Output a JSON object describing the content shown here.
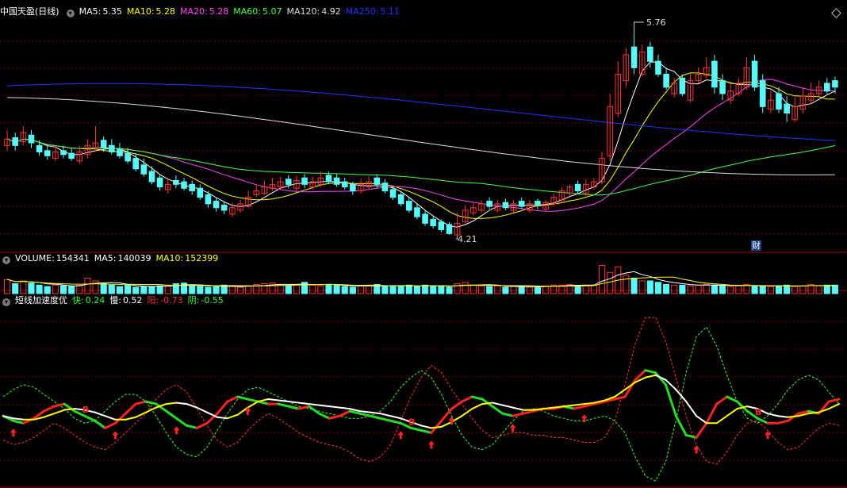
{
  "main_panel": {
    "stock_name": "中国天盈",
    "period": "(日线)",
    "indicators": [
      {
        "label": "MA5:",
        "value": "5.35",
        "color": "#ffffff"
      },
      {
        "label": "MA10:",
        "value": "5.28",
        "color": "#ffff00"
      },
      {
        "label": "MA20:",
        "value": "5.28",
        "color": "#ff44ff"
      },
      {
        "label": "MA60:",
        "value": "5.07",
        "color": "#44ff44"
      },
      {
        "label": "MA120:",
        "value": "4.92",
        "color": "#dddddd"
      },
      {
        "label": "MA250:",
        "value": "5.11",
        "color": "#2233ff"
      }
    ],
    "high_label": "5.76",
    "low_label": "4.21",
    "finance_marker": "财"
  },
  "volume_panel": {
    "indicators": [
      {
        "label": "VOLUME:",
        "value": "154341",
        "color": "#ffffff"
      },
      {
        "label": "MA5:",
        "value": "140039",
        "color": "#ffffff"
      },
      {
        "label": "MA10:",
        "value": "152399",
        "color": "#ffff00"
      }
    ]
  },
  "oscillator_panel": {
    "name": "短线加速度优",
    "indicators": [
      {
        "label": "快:",
        "value": "0.24",
        "color": "#33ff33"
      },
      {
        "label": "慢:",
        "value": "0.52",
        "color": "#ffffff"
      },
      {
        "label": "阳:",
        "value": "-0.73",
        "color": "#ff3333"
      },
      {
        "label": "阴:",
        "value": "-0.55",
        "color": "#33ff33"
      }
    ],
    "buy_markers": [
      "B",
      "B",
      "B"
    ]
  },
  "colors": {
    "up": "#ff3232",
    "down": "#54fcfc",
    "grid": "#7a0000",
    "border": "#aa0000"
  },
  "chart_data": [
    {
      "type": "candlestick",
      "ylim": [
        4.1,
        5.9
      ],
      "close": [
        4.95,
        4.9,
        5.0,
        4.92,
        4.85,
        4.82,
        4.85,
        4.83,
        4.8,
        4.85,
        4.9,
        4.92,
        4.88,
        4.85,
        4.82,
        4.78,
        4.72,
        4.68,
        4.62,
        4.58,
        4.6,
        4.6,
        4.57,
        4.55,
        4.5,
        4.45,
        4.42,
        4.4,
        4.42,
        4.45,
        4.5,
        4.55,
        4.58,
        4.6,
        4.62,
        4.6,
        4.63,
        4.6,
        4.62,
        4.65,
        4.62,
        4.6,
        4.58,
        4.55,
        4.6,
        4.62,
        4.6,
        4.55,
        4.5,
        4.45,
        4.4,
        4.35,
        4.3,
        4.28,
        4.25,
        4.22,
        4.3,
        4.4,
        4.42,
        4.45,
        4.43,
        4.45,
        4.42,
        4.45,
        4.43,
        4.45,
        4.44,
        4.46,
        4.5,
        4.55,
        4.58,
        4.55,
        4.6,
        4.62,
        4.8,
        5.2,
        5.45,
        5.6,
        5.5,
        5.62,
        5.55,
        5.45,
        5.35,
        5.38,
        5.3,
        5.4,
        5.45,
        5.5,
        5.35,
        5.3,
        5.32,
        5.38,
        5.5,
        5.35,
        5.2,
        5.25,
        5.18,
        5.15,
        5.2,
        5.28,
        5.3,
        5.35,
        5.32,
        5.35
      ],
      "open": [
        4.9,
        4.96,
        4.93,
        4.98,
        4.9,
        4.86,
        4.8,
        4.86,
        4.84,
        4.78,
        4.83,
        4.88,
        4.94,
        4.9,
        4.87,
        4.84,
        4.8,
        4.75,
        4.7,
        4.65,
        4.56,
        4.63,
        4.62,
        4.6,
        4.57,
        4.52,
        4.47,
        4.44,
        4.37,
        4.4,
        4.43,
        4.52,
        4.53,
        4.57,
        4.58,
        4.64,
        4.57,
        4.65,
        4.58,
        4.6,
        4.67,
        4.65,
        4.62,
        4.6,
        4.55,
        4.58,
        4.65,
        4.61,
        4.56,
        4.52,
        4.47,
        4.42,
        4.37,
        4.33,
        4.31,
        4.29,
        4.21,
        4.31,
        4.38,
        4.4,
        4.47,
        4.4,
        4.46,
        4.4,
        4.47,
        4.4,
        4.47,
        4.41,
        4.45,
        4.48,
        4.53,
        4.6,
        4.53,
        4.58,
        4.62,
        4.82,
        5.15,
        5.4,
        5.66,
        5.45,
        5.66,
        5.55,
        5.45,
        5.3,
        5.42,
        5.25,
        5.4,
        5.44,
        5.55,
        5.4,
        5.25,
        5.3,
        5.35,
        5.55,
        5.4,
        5.18,
        5.3,
        5.22,
        5.1,
        5.18,
        5.25,
        5.3,
        5.38,
        5.4
      ],
      "high": [
        5.02,
        5.0,
        5.05,
        5.02,
        4.94,
        4.9,
        4.9,
        4.9,
        4.88,
        4.9,
        4.95,
        5.05,
        4.97,
        4.95,
        4.92,
        4.88,
        4.84,
        4.8,
        4.74,
        4.68,
        4.64,
        4.67,
        4.65,
        4.63,
        4.6,
        4.55,
        4.5,
        4.47,
        4.46,
        4.48,
        4.55,
        4.6,
        4.63,
        4.65,
        4.66,
        4.67,
        4.67,
        4.68,
        4.66,
        4.7,
        4.7,
        4.68,
        4.65,
        4.62,
        4.64,
        4.66,
        4.68,
        4.64,
        4.58,
        4.54,
        4.5,
        4.45,
        4.4,
        4.36,
        4.33,
        4.31,
        4.38,
        4.44,
        4.46,
        4.48,
        4.5,
        4.48,
        4.49,
        4.48,
        4.5,
        4.48,
        4.49,
        4.48,
        4.53,
        4.58,
        4.6,
        4.63,
        4.64,
        4.65,
        4.85,
        5.3,
        5.55,
        5.65,
        5.76,
        5.68,
        5.7,
        5.6,
        5.5,
        5.42,
        5.45,
        5.45,
        5.5,
        5.58,
        5.6,
        5.45,
        5.38,
        5.42,
        5.58,
        5.6,
        5.45,
        5.32,
        5.35,
        5.28,
        5.28,
        5.35,
        5.38,
        5.4,
        5.42,
        5.43
      ],
      "low": [
        4.86,
        4.86,
        4.9,
        4.88,
        4.82,
        4.79,
        4.78,
        4.8,
        4.78,
        4.76,
        4.8,
        4.85,
        4.85,
        4.83,
        4.8,
        4.76,
        4.7,
        4.66,
        4.6,
        4.55,
        4.53,
        4.57,
        4.55,
        4.52,
        4.48,
        4.42,
        4.39,
        4.37,
        4.35,
        4.38,
        4.42,
        4.5,
        4.52,
        4.55,
        4.56,
        4.57,
        4.55,
        4.57,
        4.56,
        4.58,
        4.6,
        4.58,
        4.56,
        4.52,
        4.53,
        4.56,
        4.57,
        4.53,
        4.48,
        4.43,
        4.38,
        4.33,
        4.28,
        4.26,
        4.23,
        4.21,
        4.2,
        4.3,
        4.36,
        4.38,
        4.41,
        4.38,
        4.4,
        4.38,
        4.41,
        4.38,
        4.41,
        4.39,
        4.43,
        4.46,
        4.51,
        4.53,
        4.51,
        4.56,
        4.6,
        4.78,
        5.12,
        5.35,
        5.45,
        5.43,
        5.5,
        5.43,
        5.33,
        5.27,
        5.28,
        5.23,
        5.38,
        5.42,
        5.3,
        5.25,
        5.22,
        5.28,
        5.33,
        5.32,
        5.15,
        5.15,
        5.15,
        5.08,
        5.08,
        5.15,
        5.22,
        5.28,
        5.3,
        5.3
      ]
    },
    {
      "type": "bar",
      "title": "VOLUME",
      "values": [
        20,
        14,
        18,
        15,
        12,
        10,
        12,
        11,
        10,
        12,
        22,
        18,
        14,
        12,
        10,
        12,
        9,
        10,
        10,
        11,
        12,
        14,
        15,
        11,
        10,
        9,
        10,
        12,
        10,
        9,
        11,
        13,
        14,
        15,
        12,
        11,
        13,
        16,
        12,
        11,
        13,
        12,
        10,
        9,
        11,
        12,
        13,
        11,
        10,
        11,
        12,
        10,
        12,
        11,
        10,
        9,
        14,
        16,
        12,
        11,
        10,
        11,
        9,
        10,
        10,
        9,
        10,
        11,
        12,
        12,
        13,
        11,
        12,
        12,
        40,
        30,
        38,
        26,
        22,
        18,
        18,
        16,
        13,
        12,
        12,
        11,
        12,
        13,
        12,
        11,
        10,
        11,
        13,
        11,
        10,
        10,
        11,
        12,
        10,
        11,
        13,
        11,
        12,
        12
      ],
      "ylim": [
        0,
        45
      ]
    },
    {
      "type": "line",
      "title": "短线加速度优",
      "series": [
        {
          "name": "快",
          "values": [
            -0.3,
            -0.5,
            -0.6,
            -0.4,
            -0.1,
            0.1,
            0.2,
            -0.1,
            -0.3,
            -0.5,
            -0.8,
            -0.6,
            -0.2,
            0.2,
            0.3,
            0.2,
            -0.1,
            -0.4,
            -0.7,
            -0.8,
            -0.6,
            -0.2,
            0.3,
            0.5,
            0.4,
            0.3,
            0.2,
            0.2,
            0.1,
            0.0,
            0.1,
            -0.2,
            -0.4,
            -0.3,
            -0.1,
            -0.2,
            -0.3,
            -0.4,
            -0.5,
            -0.6,
            -0.8,
            -0.9,
            -1.0,
            -0.5,
            0.0,
            0.3,
            0.5,
            0.4,
            0.1,
            -0.2,
            -0.3,
            -0.2,
            -0.1,
            0.0,
            0.0,
            0.1,
            0.0,
            0.1,
            0.2,
            0.3,
            0.4,
            0.5,
            1.2,
            1.6,
            1.5,
            1.0,
            -0.3,
            -1.1,
            -1.2,
            -0.6,
            0.2,
            0.5,
            0.3,
            -0.1,
            -0.4,
            -0.6,
            -0.6,
            -0.5,
            -0.2,
            -0.1,
            -0.2,
            0.3,
            0.4
          ],
          "color": "#33ff33"
        },
        {
          "name": "慢",
          "values": [
            -0.3,
            -0.4,
            -0.45,
            -0.45,
            -0.35,
            -0.2,
            -0.05,
            0.0,
            -0.05,
            -0.15,
            -0.3,
            -0.45,
            -0.45,
            -0.35,
            -0.15,
            0.05,
            0.2,
            0.25,
            0.2,
            0.05,
            -0.15,
            -0.35,
            -0.4,
            -0.25,
            0.05,
            0.3,
            0.4,
            0.35,
            0.3,
            0.25,
            0.2,
            0.15,
            0.1,
            0.05,
            0.0,
            -0.1,
            -0.15,
            -0.2,
            -0.3,
            -0.4,
            -0.55,
            -0.7,
            -0.8,
            -0.75,
            -0.55,
            -0.3,
            0.0,
            0.2,
            0.25,
            0.15,
            0.05,
            -0.05,
            -0.05,
            0.0,
            0.05,
            0.1,
            0.15,
            0.2,
            0.25,
            0.35,
            0.5,
            0.8,
            1.1,
            1.3,
            1.4,
            1.2,
            0.8,
            0.3,
            -0.3,
            -0.6,
            -0.6,
            -0.3,
            0.0,
            0.1,
            0.0,
            -0.2,
            -0.3,
            -0.35,
            -0.3,
            -0.2,
            -0.15,
            0.0,
            0.2
          ],
          "color": "#ffffff"
        },
        {
          "name": "阳",
          "values": [
            -1.3,
            -1.5,
            -1.4,
            -1.2,
            -0.9,
            -0.6,
            -0.8,
            -1.1,
            -1.4,
            -1.6,
            -1.7,
            -1.4,
            -1.0,
            -0.6,
            -0.2,
            0.4,
            0.8,
            1.0,
            0.7,
            0.0,
            -0.7,
            -1.3,
            -1.6,
            -1.4,
            -0.9,
            -0.5,
            -0.2,
            -0.4,
            -0.7,
            -1.0,
            -1.2,
            -1.4,
            -1.5,
            -1.6,
            -1.8,
            -2.1,
            -2.2,
            -2.0,
            -1.5,
            -0.5,
            0.5,
            1.3,
            1.8,
            1.5,
            0.8,
            0.2,
            -0.4,
            -0.9,
            -1.2,
            -1.1,
            -1.0,
            -1.0,
            -1.1,
            -1.1,
            -1.2,
            -1.2,
            -1.3,
            -1.4,
            -1.4,
            -1.2,
            -0.5,
            1.0,
            2.7,
            3.8,
            3.8,
            2.8,
            1.3,
            -0.3,
            -1.5,
            -2.2,
            -2.3,
            -1.8,
            -1.1,
            -0.6,
            -0.5,
            -0.9,
            -1.4,
            -1.7,
            -1.6,
            -1.2,
            -0.8,
            -0.6,
            -0.7
          ],
          "color": "#ff3333"
        },
        {
          "name": "阴",
          "values": [
            0.5,
            0.8,
            1.0,
            0.9,
            0.6,
            0.3,
            0.0,
            -0.4,
            -0.6,
            -0.5,
            -0.1,
            0.3,
            0.6,
            0.6,
            0.3,
            -0.3,
            -1.0,
            -1.6,
            -1.9,
            -2.0,
            -1.6,
            -0.9,
            -0.2,
            0.4,
            0.8,
            0.9,
            0.7,
            0.5,
            0.3,
            0.1,
            0.0,
            -0.1,
            -0.2,
            -0.3,
            -0.4,
            -0.4,
            -0.3,
            -0.1,
            0.3,
            0.9,
            1.3,
            1.6,
            1.3,
            0.6,
            -0.3,
            -1.1,
            -1.6,
            -1.7,
            -1.5,
            -1.0,
            -0.5,
            -0.1,
            0.0,
            -0.1,
            -0.3,
            -0.4,
            -0.5,
            -0.5,
            -0.4,
            -0.3,
            -0.5,
            -1.0,
            -2.0,
            -2.8,
            -3.0,
            -2.2,
            -0.5,
            1.5,
            3.0,
            3.4,
            2.6,
            1.4,
            0.3,
            -0.4,
            -0.6,
            -0.3,
            0.2,
            0.8,
            1.2,
            1.4,
            1.2,
            0.7,
            0.2
          ],
          "color": "#33ff33"
        }
      ],
      "ylim": [
        -3.2,
        4.2
      ]
    }
  ]
}
